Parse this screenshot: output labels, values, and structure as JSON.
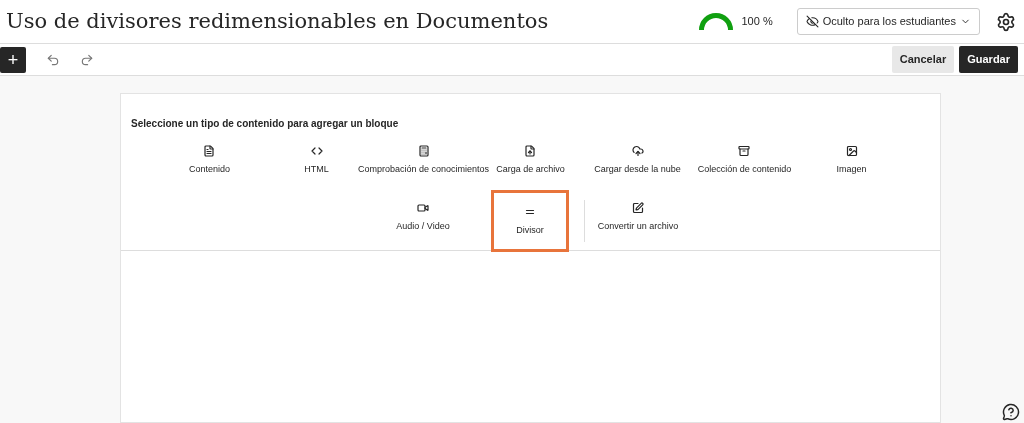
{
  "header": {
    "title": "Uso de divisores redimensionables en Documentos",
    "progress": {
      "level": 1,
      "reading": "100 %"
    },
    "visibility": "Oculto para los estudiantes"
  },
  "toolbar": {
    "add": "+",
    "cancel": "Cancelar",
    "save": "Guardar"
  },
  "picker": {
    "prompt": "Seleccione un tipo de contenido para agregar un bloque",
    "rows": [
      {
        "options": [
          {
            "kind": "content",
            "label": "Contenido",
            "highlighted": false,
            "separator_before": false
          },
          {
            "kind": "html",
            "label": "HTML",
            "highlighted": false,
            "separator_before": false
          },
          {
            "kind": "check",
            "label": "Comprobación de conocimientos",
            "highlighted": false,
            "separator_before": false
          },
          {
            "kind": "upload",
            "label": "Carga de archivo",
            "highlighted": false,
            "separator_before": false
          },
          {
            "kind": "cloud",
            "label": "Cargar desde la nube",
            "highlighted": false,
            "separator_before": false
          },
          {
            "kind": "collection",
            "label": "Colección de contenido",
            "highlighted": false,
            "separator_before": false
          },
          {
            "kind": "image",
            "label": "Imagen",
            "highlighted": false,
            "separator_before": false
          }
        ]
      },
      {
        "options": [
          {
            "kind": "video",
            "label": "Audio / Video",
            "highlighted": false,
            "separator_before": false
          },
          {
            "kind": "divider",
            "label": "Divisor",
            "highlighted": true,
            "separator_before": false
          },
          {
            "kind": "convert",
            "label": "Convertir un archivo",
            "highlighted": false,
            "separator_before": true
          }
        ]
      }
    ]
  }
}
